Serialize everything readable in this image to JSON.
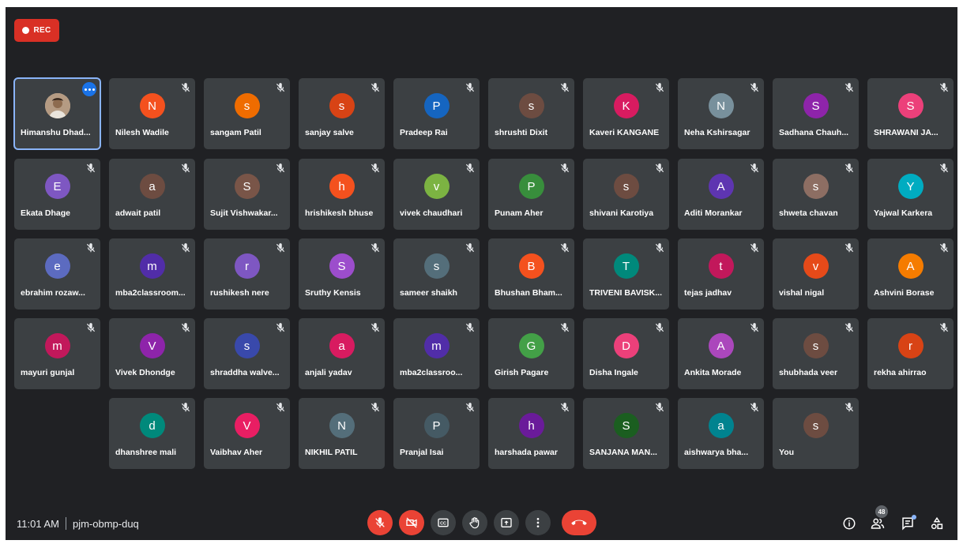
{
  "recording": {
    "label": "REC"
  },
  "meeting": {
    "time": "11:01 AM",
    "code": "pjm-obmp-duq"
  },
  "participants_count": "48",
  "colors": {
    "background": "#202124",
    "tile": "#3c4043",
    "accent": "#1a73e8",
    "danger": "#ea4335"
  },
  "participants": [
    {
      "name": "Himanshu Dhad...",
      "initial": "",
      "color": "#c8b9a6",
      "photo": true,
      "active": true
    },
    {
      "name": "Nilesh Wadile",
      "initial": "N",
      "color": "#f4511e"
    },
    {
      "name": "sangam Patil",
      "initial": "s",
      "color": "#ef6c00"
    },
    {
      "name": "sanjay salve",
      "initial": "s",
      "color": "#d84315"
    },
    {
      "name": "Pradeep Rai",
      "initial": "P",
      "color": "#1565c0"
    },
    {
      "name": "shrushti Dixit",
      "initial": "s",
      "color": "#6d4c41"
    },
    {
      "name": "Kaveri KANGANE",
      "initial": "K",
      "color": "#d81b60"
    },
    {
      "name": "Neha Kshirsagar",
      "initial": "N",
      "color": "#78909c"
    },
    {
      "name": "Sadhana Chauh...",
      "initial": "S",
      "color": "#8e24aa"
    },
    {
      "name": "SHRAWANI JA...",
      "initial": "S",
      "color": "#ec407a"
    },
    {
      "name": "Ekata Dhage",
      "initial": "E",
      "color": "#7e57c2"
    },
    {
      "name": "adwait patil",
      "initial": "a",
      "color": "#6d4c41"
    },
    {
      "name": "Sujit Vishwakar...",
      "initial": "S",
      "color": "#795548"
    },
    {
      "name": "hrishikesh bhuse",
      "initial": "h",
      "color": "#f4511e"
    },
    {
      "name": "vivek chaudhari",
      "initial": "v",
      "color": "#7cb342"
    },
    {
      "name": "Punam Aher",
      "initial": "P",
      "color": "#388e3c"
    },
    {
      "name": "shivani Karotiya",
      "initial": "s",
      "color": "#6d4c41"
    },
    {
      "name": "Aditi Morankar",
      "initial": "A",
      "color": "#5e35b1"
    },
    {
      "name": "shweta chavan",
      "initial": "s",
      "color": "#8d6e63"
    },
    {
      "name": "Yajwal Karkera",
      "initial": "Y",
      "color": "#00acc1"
    },
    {
      "name": "ebrahim rozaw...",
      "initial": "e",
      "color": "#5c6bc0"
    },
    {
      "name": "mba2classroom...",
      "initial": "m",
      "color": "#512da8"
    },
    {
      "name": "rushikesh nere",
      "initial": "r",
      "color": "#7e57c2"
    },
    {
      "name": "Sruthy Kensis",
      "initial": "S",
      "color": "#9c4dcc"
    },
    {
      "name": "sameer shaikh",
      "initial": "s",
      "color": "#546e7a"
    },
    {
      "name": "Bhushan Bham...",
      "initial": "B",
      "color": "#f4511e"
    },
    {
      "name": "TRIVENI BAVISK...",
      "initial": "T",
      "color": "#00897b"
    },
    {
      "name": "tejas jadhav",
      "initial": "t",
      "color": "#c2185b"
    },
    {
      "name": "vishal nigal",
      "initial": "v",
      "color": "#e64a19"
    },
    {
      "name": "Ashvini Borase",
      "initial": "A",
      "color": "#f57c00"
    },
    {
      "name": "mayuri gunjal",
      "initial": "m",
      "color": "#c2185b"
    },
    {
      "name": "Vivek Dhondge",
      "initial": "V",
      "color": "#8e24aa"
    },
    {
      "name": "shraddha walve...",
      "initial": "s",
      "color": "#3949ab"
    },
    {
      "name": "anjali yadav",
      "initial": "a",
      "color": "#d81b60"
    },
    {
      "name": "mba2classroo...",
      "initial": "m",
      "color": "#512da8"
    },
    {
      "name": "Girish Pagare",
      "initial": "G",
      "color": "#43a047"
    },
    {
      "name": "Disha Ingale",
      "initial": "D",
      "color": "#ec407a"
    },
    {
      "name": "Ankita Morade",
      "initial": "A",
      "color": "#ab47bc"
    },
    {
      "name": "shubhada veer",
      "initial": "s",
      "color": "#6d4c41"
    },
    {
      "name": "rekha ahirrao",
      "initial": "r",
      "color": "#d84315"
    },
    {
      "name": "dhanshree mali",
      "initial": "d",
      "color": "#00897b"
    },
    {
      "name": "Vaibhav Aher",
      "initial": "V",
      "color": "#e91e63"
    },
    {
      "name": "NIKHIL PATIL",
      "initial": "N",
      "color": "#546e7a"
    },
    {
      "name": "Pranjal Isai",
      "initial": "P",
      "color": "#455a64"
    },
    {
      "name": "harshada pawar",
      "initial": "h",
      "color": "#6a1b9a"
    },
    {
      "name": "SANJANA MAN...",
      "initial": "S",
      "color": "#1b5e20"
    },
    {
      "name": "aishwarya bha...",
      "initial": "a",
      "color": "#00838f"
    },
    {
      "name": "You",
      "initial": "s",
      "color": "#6d4c41"
    }
  ],
  "controls": [
    {
      "name": "mic-toggle-button",
      "icon": "mic-off-icon",
      "style": "red"
    },
    {
      "name": "camera-toggle-button",
      "icon": "camera-off-icon",
      "style": "red"
    },
    {
      "name": "captions-button",
      "icon": "captions-icon",
      "style": "gray"
    },
    {
      "name": "raise-hand-button",
      "icon": "hand-icon",
      "style": "gray"
    },
    {
      "name": "present-button",
      "icon": "present-icon",
      "style": "gray"
    },
    {
      "name": "more-options-button",
      "icon": "more-vert-icon",
      "style": "gray"
    },
    {
      "name": "leave-call-button",
      "icon": "call-end-icon",
      "style": "end"
    }
  ],
  "right_controls": [
    {
      "name": "meeting-info-button",
      "icon": "info-icon"
    },
    {
      "name": "people-button",
      "icon": "people-icon"
    },
    {
      "name": "chat-button",
      "icon": "chat-icon"
    },
    {
      "name": "activities-button",
      "icon": "activities-icon"
    }
  ]
}
